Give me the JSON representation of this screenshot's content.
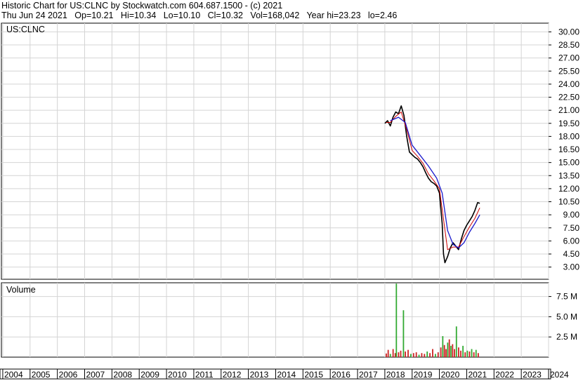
{
  "header": {
    "line1": "Historic Chart for US:CLNC by Stockwatch.com 604.687.1500 - (c) 2021",
    "line2": "Thu Jun 24 2021   Op=10.21   Hi=10.34   Lo=10.10   Cl=10.32   Vol=168,042   Year hi=23.23   lo=2.46"
  },
  "chart_data": {
    "type": "line",
    "symbol": "US:CLNC",
    "price_axis": {
      "ticks": [
        "30.00",
        "28.50",
        "27.00",
        "25.50",
        "24.00",
        "22.50",
        "21.00",
        "19.50",
        "18.00",
        "16.50",
        "15.00",
        "13.50",
        "12.00",
        "10.50",
        "9.00",
        "7.50",
        "6.00",
        "4.50",
        "3.00"
      ],
      "ylim": [
        1.6,
        31.0
      ]
    },
    "volume_axis": {
      "title": "Volume",
      "ticks": [
        "7.5 M",
        "5.0 M",
        "2.5 M"
      ],
      "tick_values": [
        7.5,
        5.0,
        2.5
      ],
      "ylim": [
        0,
        9.2
      ]
    },
    "x_axis": {
      "labels": [
        "2004",
        "2005",
        "2006",
        "2007",
        "2008",
        "2009",
        "2010",
        "2011",
        "2012",
        "2013",
        "2014",
        "2015",
        "2016",
        "2017",
        "2018",
        "2019",
        "2020",
        "2021",
        "2022",
        "2023",
        "2024"
      ],
      "xlim": [
        2003.95,
        2024.0
      ]
    },
    "colors": {
      "price": "#000000",
      "ma_short": "#cc0000",
      "ma_long": "#1a1acc",
      "vol_up": "#33aa33",
      "vol_down": "#cc2222",
      "grid": "#d4d4d4"
    },
    "series": [
      {
        "values": [
          [
            2018.0,
            19.5
          ],
          [
            2018.1,
            19.8
          ],
          [
            2018.2,
            19.2
          ],
          [
            2018.3,
            20.2
          ],
          [
            2018.4,
            20.8
          ],
          [
            2018.5,
            20.6
          ],
          [
            2018.6,
            21.5
          ],
          [
            2018.7,
            20.4
          ],
          [
            2018.8,
            18.0
          ],
          [
            2018.9,
            16.2
          ],
          [
            2019.0,
            15.9
          ],
          [
            2019.1,
            15.6
          ],
          [
            2019.2,
            15.4
          ],
          [
            2019.3,
            15.0
          ],
          [
            2019.4,
            14.5
          ],
          [
            2019.5,
            13.8
          ],
          [
            2019.6,
            13.2
          ],
          [
            2019.7,
            12.8
          ],
          [
            2019.8,
            12.6
          ],
          [
            2019.9,
            12.3
          ],
          [
            2020.0,
            11.5
          ],
          [
            2020.1,
            8.0
          ],
          [
            2020.15,
            4.5
          ],
          [
            2020.2,
            3.5
          ],
          [
            2020.3,
            4.2
          ],
          [
            2020.4,
            5.2
          ],
          [
            2020.5,
            5.8
          ],
          [
            2020.6,
            5.4
          ],
          [
            2020.7,
            5.0
          ],
          [
            2020.8,
            6.2
          ],
          [
            2020.9,
            7.2
          ],
          [
            2021.0,
            7.8
          ],
          [
            2021.1,
            8.3
          ],
          [
            2021.2,
            8.8
          ],
          [
            2021.3,
            9.5
          ],
          [
            2021.4,
            10.4
          ],
          [
            2021.48,
            10.32
          ]
        ]
      },
      {
        "values": [
          [
            2018.05,
            19.6
          ],
          [
            2018.2,
            19.6
          ],
          [
            2018.4,
            20.3
          ],
          [
            2018.6,
            20.8
          ],
          [
            2018.8,
            18.8
          ],
          [
            2019.0,
            16.4
          ],
          [
            2019.2,
            15.7
          ],
          [
            2019.4,
            14.9
          ],
          [
            2019.6,
            13.7
          ],
          [
            2019.8,
            12.9
          ],
          [
            2020.0,
            12.0
          ],
          [
            2020.15,
            8.5
          ],
          [
            2020.3,
            5.0
          ],
          [
            2020.5,
            5.3
          ],
          [
            2020.7,
            5.3
          ],
          [
            2020.9,
            6.5
          ],
          [
            2021.1,
            7.6
          ],
          [
            2021.3,
            8.6
          ],
          [
            2021.48,
            9.8
          ]
        ]
      },
      {
        "values": [
          [
            2018.2,
            19.8
          ],
          [
            2018.5,
            20.2
          ],
          [
            2018.75,
            19.6
          ],
          [
            2019.0,
            17.0
          ],
          [
            2019.3,
            15.8
          ],
          [
            2019.6,
            14.6
          ],
          [
            2019.9,
            13.2
          ],
          [
            2020.1,
            11.5
          ],
          [
            2020.3,
            7.2
          ],
          [
            2020.5,
            5.6
          ],
          [
            2020.7,
            5.2
          ],
          [
            2020.9,
            5.8
          ],
          [
            2021.1,
            7.0
          ],
          [
            2021.3,
            8.0
          ],
          [
            2021.48,
            9.0
          ]
        ]
      }
    ],
    "volume": [
      {
        "x": 2018.05,
        "v": 0.45,
        "up": false
      },
      {
        "x": 2018.12,
        "v": 0.9,
        "up": false
      },
      {
        "x": 2018.2,
        "v": 0.4,
        "up": true
      },
      {
        "x": 2018.3,
        "v": 1.0,
        "up": false
      },
      {
        "x": 2018.38,
        "v": 0.5,
        "up": false
      },
      {
        "x": 2018.42,
        "v": 9.1,
        "up": true
      },
      {
        "x": 2018.5,
        "v": 0.6,
        "up": false
      },
      {
        "x": 2018.58,
        "v": 0.8,
        "up": false
      },
      {
        "x": 2018.68,
        "v": 5.8,
        "up": true
      },
      {
        "x": 2018.75,
        "v": 0.7,
        "up": false
      },
      {
        "x": 2018.85,
        "v": 0.9,
        "up": false
      },
      {
        "x": 2018.95,
        "v": 0.4,
        "up": true
      },
      {
        "x": 2019.05,
        "v": 0.5,
        "up": false
      },
      {
        "x": 2019.15,
        "v": 0.6,
        "up": false
      },
      {
        "x": 2019.25,
        "v": 0.3,
        "up": true
      },
      {
        "x": 2019.35,
        "v": 0.5,
        "up": false
      },
      {
        "x": 2019.45,
        "v": 0.4,
        "up": false
      },
      {
        "x": 2019.55,
        "v": 0.7,
        "up": true
      },
      {
        "x": 2019.65,
        "v": 0.5,
        "up": false
      },
      {
        "x": 2019.75,
        "v": 1.0,
        "up": false
      },
      {
        "x": 2019.85,
        "v": 0.4,
        "up": true
      },
      {
        "x": 2019.95,
        "v": 0.6,
        "up": false
      },
      {
        "x": 2020.05,
        "v": 1.2,
        "up": false
      },
      {
        "x": 2020.12,
        "v": 2.6,
        "up": true
      },
      {
        "x": 2020.18,
        "v": 1.5,
        "up": false
      },
      {
        "x": 2020.24,
        "v": 1.0,
        "up": false
      },
      {
        "x": 2020.3,
        "v": 1.8,
        "up": true
      },
      {
        "x": 2020.36,
        "v": 2.2,
        "up": false
      },
      {
        "x": 2020.42,
        "v": 1.4,
        "up": true
      },
      {
        "x": 2020.48,
        "v": 1.6,
        "up": false
      },
      {
        "x": 2020.55,
        "v": 1.0,
        "up": false
      },
      {
        "x": 2020.62,
        "v": 3.8,
        "up": true
      },
      {
        "x": 2020.7,
        "v": 1.2,
        "up": false
      },
      {
        "x": 2020.78,
        "v": 0.8,
        "up": false
      },
      {
        "x": 2020.86,
        "v": 1.4,
        "up": true
      },
      {
        "x": 2020.94,
        "v": 0.6,
        "up": false
      },
      {
        "x": 2021.02,
        "v": 0.8,
        "up": true
      },
      {
        "x": 2021.1,
        "v": 0.7,
        "up": false
      },
      {
        "x": 2021.18,
        "v": 1.0,
        "up": true
      },
      {
        "x": 2021.26,
        "v": 0.6,
        "up": false
      },
      {
        "x": 2021.34,
        "v": 0.9,
        "up": true
      },
      {
        "x": 2021.42,
        "v": 0.5,
        "up": false
      }
    ]
  }
}
